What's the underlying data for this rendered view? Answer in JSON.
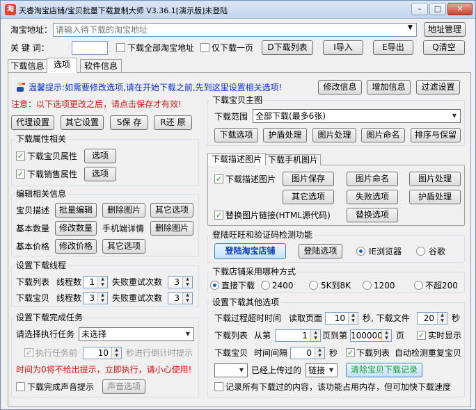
{
  "window": {
    "title": "天睿淘宝店铺/宝贝批量下载复制大师 V3.36.1[演示版]未登陆",
    "controls": [
      "0",
      "1",
      "r"
    ]
  },
  "top": {
    "url_label": "淘宝地址：",
    "url_placeholder": "请输入待下载的淘宝地址",
    "manage_btn": "地址管理",
    "keyword_label": "关 键 词：",
    "keyword_value": "",
    "cb_all_url": "下载全部淘宝地址",
    "cb_one_page": "仅下载一页",
    "btn_dlist": "D下载列表",
    "btn_import": "I导入",
    "btn_export": "E导出",
    "btn_clear": "Q清空"
  },
  "tabs": [
    "下载信息",
    "选项",
    "软件信息"
  ],
  "tip": {
    "text": "温馨提示:如需要修改选项,请在开始下载之前,先到这里设置相关选项!",
    "btn_edit_info": "修改信息",
    "btn_add_info": "增加信息",
    "btn_filter": "过滤设置",
    "warning": "注意：以下选项更改之后，请点击保存才有效!"
  },
  "left_buttons": {
    "proxy": "代理设置",
    "other": "其它设置",
    "save": "S保 存",
    "restore": "R还 原"
  },
  "attr_group": {
    "title": "下载属性相关",
    "cb_item_attr": "下载宝贝属性",
    "cb_sale_attr": "下载销售属性",
    "opt": "选项"
  },
  "edit_group": {
    "title": "编辑相关信息",
    "desc_label": "宝贝描述",
    "batch_edit": "批量编辑",
    "del_image": "删除图片",
    "other_opt": "其它选项",
    "qty_label": "基本数量",
    "edit_qty": "修改数量",
    "mobile_detail": "手机端详情",
    "del_image2": "删除图片",
    "price_label": "基本价格",
    "edit_price": "修改价格",
    "other_opt2": "其它选项"
  },
  "thread_group": {
    "title": "设置下载线程",
    "list_label": "下载列表",
    "item_label": "下载宝贝",
    "thread_label": "线程数",
    "retry_label": "失败重试次数",
    "list_threads": "1",
    "list_retry": "3",
    "item_threads": "3",
    "item_retry": "3"
  },
  "complete_group": {
    "title": "设置下载完成任务",
    "task_label": "请选择执行任务",
    "task_value": "未选择",
    "cb_before": "执行任务前",
    "before_value": "10",
    "countdown": "秒进行倒计时提示",
    "zero_tip": "时间为0将不给出提示，立即执行，请小心使用!",
    "cb_sound": "下载完成声音提示",
    "sound_opt": "声音选项"
  },
  "main_image": {
    "title": "下载宝贝主图",
    "range_label": "下载范围",
    "range_value": "全部下载(最多6张)",
    "dl_opt": "下载选项",
    "shield": "护盾处理",
    "img_proc": "图片处理",
    "img_name": "图片命名",
    "sort_save": "排序与保留"
  },
  "desc_image": {
    "tab_desc": "下载描述图片",
    "tab_mobile": "下载手机图片",
    "cb_desc": "下载描述图片",
    "img_save": "图片保存",
    "img_name": "图片命名",
    "img_proc": "图片处理",
    "other_opt": "其它选项",
    "fail_opt": "失败选项",
    "shield": "护盾处理",
    "cb_replace": "替换图片链接(HTML源代码)",
    "replace_opt": "替换选项"
  },
  "login_group": {
    "title": "登陆旺旺和验证码检测功能",
    "login_shop": "登陆淘宝店铺",
    "login_opt": "登陆选项",
    "ie": "IE浏览器",
    "chrome": "谷歌"
  },
  "mode_group": {
    "title": "下载店铺采用哪种方式",
    "options": [
      "直接下载",
      "2400",
      "5K到8K",
      "1200",
      "不超200"
    ],
    "selected": "直接下载"
  },
  "other_group": {
    "title": "设置下载其他选项",
    "timeout_label": "下载过程超时时间",
    "read_page": "读取页面",
    "read_value": "10",
    "sec_dl_file": "秒, 下载文件",
    "file_value": "20",
    "sec": "秒",
    "list_label": "下载列表",
    "from_page": "从第",
    "from_value": "1",
    "to_page": "页到第",
    "to_value": "100000",
    "page": "页",
    "cb_realtime": "实时显示",
    "item_label": "下载宝贝",
    "interval": "时间间隔",
    "interval_value": "0",
    "sec2": "秒",
    "cb_dedup": "下载列表",
    "dedup_text": "自动检测重复宝贝",
    "uploaded_select": "",
    "uploaded_label": "已经上传过的",
    "link_value": "链接",
    "clear_records": "清除宝贝下载记录",
    "cb_record": "记录所有下载过的内容，该功能占用内存，但可加快下载速度"
  }
}
